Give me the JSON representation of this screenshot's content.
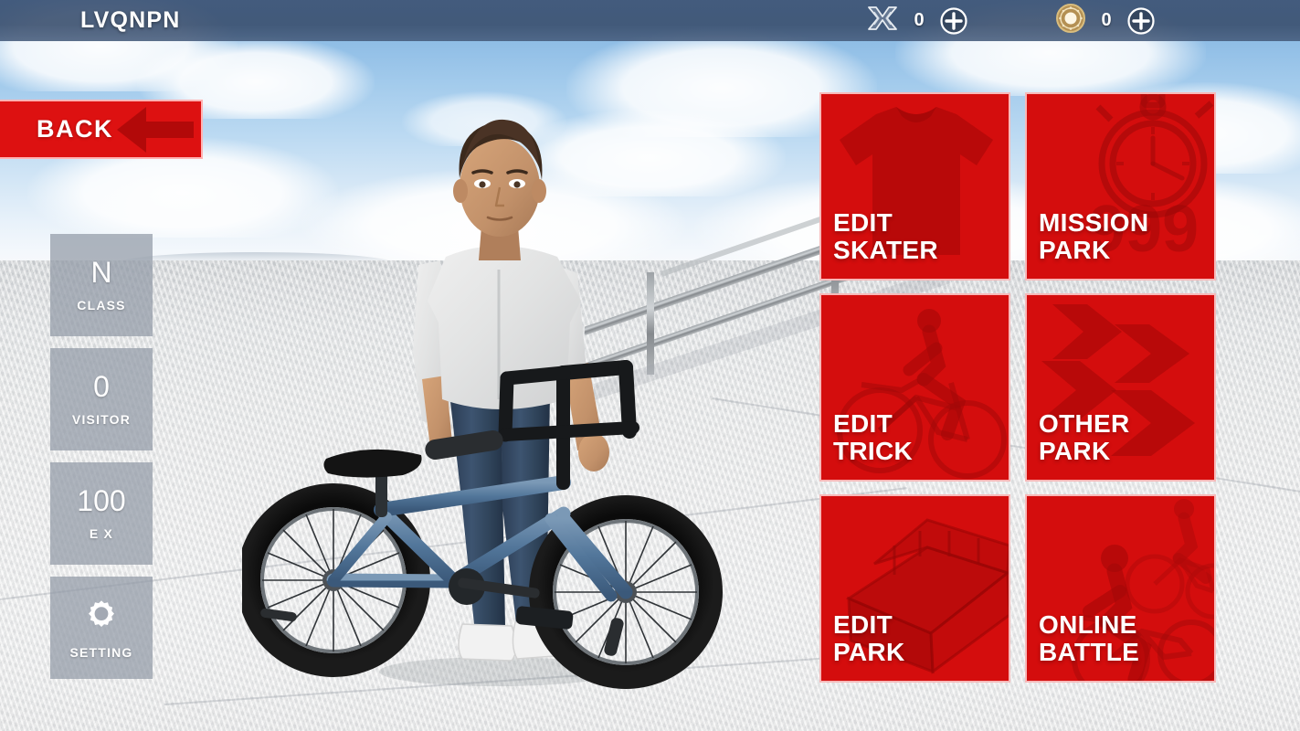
{
  "header": {
    "app_title": "LVQNPN",
    "currencies": [
      {
        "icon": "x-ticket-icon",
        "name": "x-ticket",
        "value": "0",
        "add_icon": "plus-circle-icon"
      },
      {
        "icon": "coin-icon",
        "name": "coin",
        "value": "0",
        "add_icon": "plus-circle-icon"
      }
    ]
  },
  "back_button": {
    "label": "BACK",
    "icon": "back-arrow-icon"
  },
  "sidebar": {
    "tiles": [
      {
        "value": "N",
        "label": "CLASS",
        "icon": ""
      },
      {
        "value": "0",
        "label": "VISITOR",
        "icon": ""
      },
      {
        "value": "100",
        "label": "E X",
        "icon": ""
      },
      {
        "value": "",
        "label": "SETTING",
        "icon": "gear-icon"
      }
    ]
  },
  "menu": {
    "tiles": [
      {
        "label": "EDIT\nSKATER",
        "art": "tshirt-icon"
      },
      {
        "label": "MISSION\nPARK",
        "art": "stopwatch-icon",
        "art_text": "999"
      },
      {
        "label": "EDIT\nTRICK",
        "art": "bmx-rider-icon"
      },
      {
        "label": "OTHER\nPARK",
        "art": "arrows-right-icon"
      },
      {
        "label": "EDIT\nPARK",
        "art": "ramp-icon"
      },
      {
        "label": "ONLINE\nBATTLE",
        "art": "two-bmx-riders-icon"
      }
    ]
  },
  "scene": {
    "character": "bmx-skater-avatar",
    "vehicle": "bmx-bike",
    "environment": "skatepark-handrail"
  },
  "colors": {
    "accent_red": "#d40d0d",
    "back_red": "#dd1111",
    "topbar": "#3e5475",
    "tile_grey": "#929aa6",
    "bike_blue": "#5c7f9e"
  }
}
